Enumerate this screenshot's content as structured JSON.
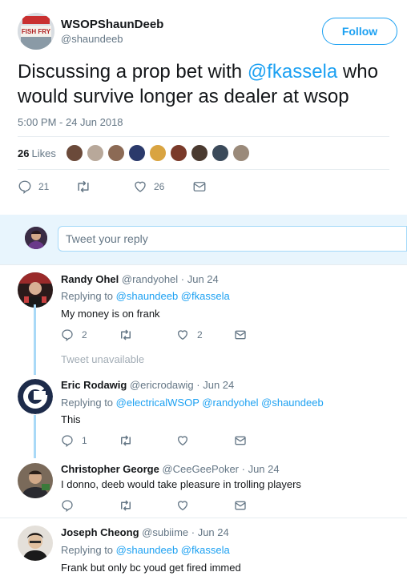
{
  "tweet": {
    "author_name": "WSOPShaunDeeb",
    "author_handle": "@shaundeeb",
    "avatar_text": "FISH FRY",
    "follow_label": "Follow",
    "text_before": "Discussing a prop bet with ",
    "mention": "@fkassela",
    "text_after": " who would survive longer as dealer at wsop",
    "time": "5:00 PM - 24 Jun 2018",
    "likes_count": "26",
    "likes_label": "Likes",
    "likers_colors": [
      "#6b4a3a",
      "#b8a89a",
      "#8c6a55",
      "#2b3a6b",
      "#d9a441",
      "#7a3a2a",
      "#4a3a30",
      "#3b4a5a",
      "#9a8a7a"
    ],
    "replies_count": "21",
    "retweets_count": "",
    "likes_action_count": "26"
  },
  "composer": {
    "placeholder": "Tweet your reply"
  },
  "replies": [
    {
      "name": "Randy Ohel",
      "handle": "@randyohel",
      "date": "· Jun 24",
      "replying_prefix": "Replying to ",
      "replying_to": "@shaundeeb @fkassela",
      "text": "My money is on frank",
      "reply_count": "2",
      "like_count": "2"
    },
    {
      "unavailable": "Tweet unavailable"
    },
    {
      "name": "Eric Rodawig",
      "handle": "@ericrodawig",
      "date": "· Jun 24",
      "replying_prefix": "Replying to ",
      "replying_to": "@electricalWSOP @randyohel @shaundeeb",
      "text": "This",
      "reply_count": "1",
      "like_count": ""
    },
    {
      "name": "Christopher George",
      "handle": "@CeeGeePoker",
      "date": "· Jun 24",
      "text": "I donno, deeb would take pleasure in trolling players",
      "reply_count": "",
      "like_count": ""
    },
    {
      "name": "Joseph Cheong",
      "handle": "@subiime",
      "date": "· Jun 24",
      "replying_prefix": "Replying to ",
      "replying_to": "@shaundeeb @fkassela",
      "text": "Frank but only bc youd get fired immed"
    }
  ],
  "colors": {
    "accent": "#1da1f2",
    "muted": "#657786",
    "composer_bg": "#e8f5fd",
    "thread_line": "#a9d9f7"
  }
}
